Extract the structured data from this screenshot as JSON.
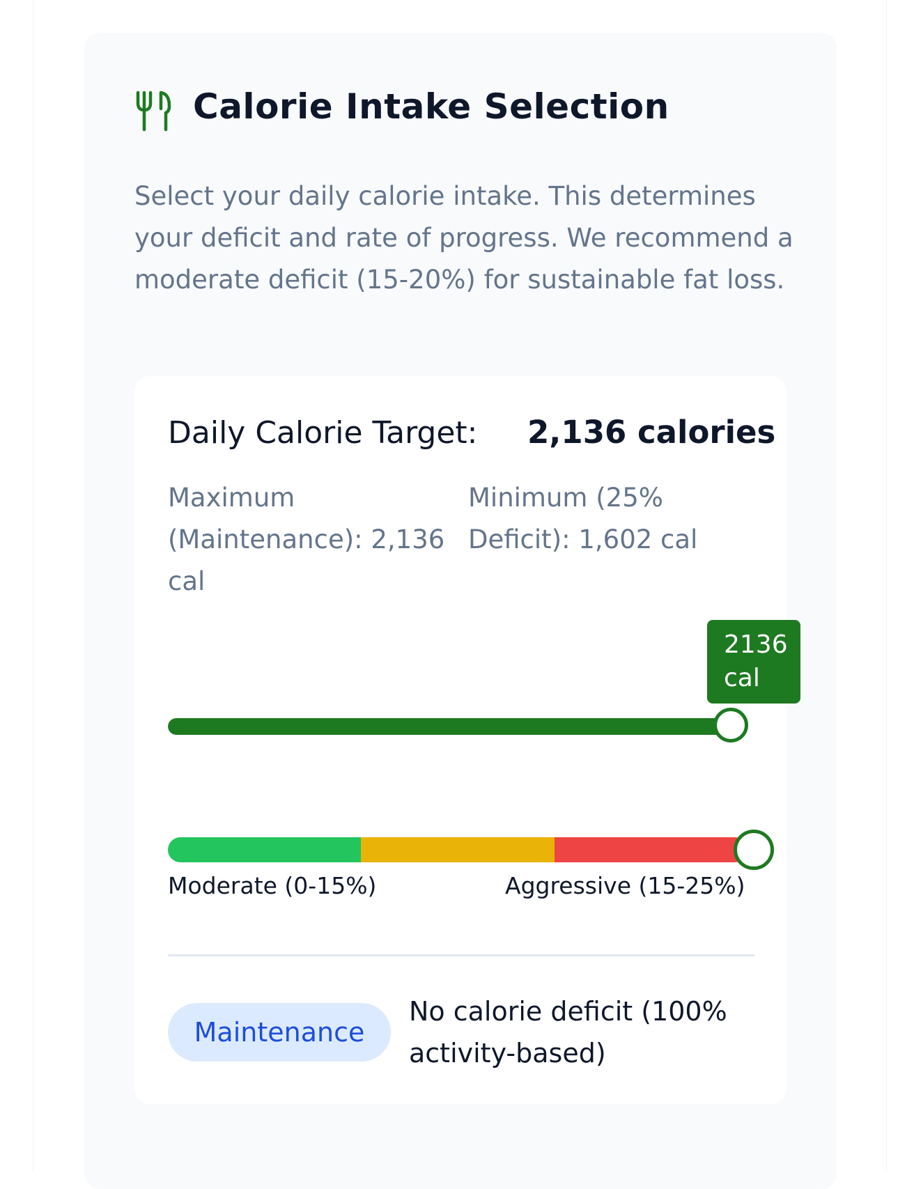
{
  "section": {
    "icon": "utensils-icon",
    "title": "Calorie Intake Selection",
    "description": "Select your daily calorie intake. This determines your deficit and rate of progress. We recommend a moderate deficit (15-20%) for sustainable fat loss."
  },
  "target": {
    "label": "Daily Calorie Target:",
    "value": "2,136 calories",
    "max_text": "Maximum (Maintenance): 2,136 cal",
    "min_text": "Minimum (25% Deficit): 1,602 cal"
  },
  "slider": {
    "min": 1602,
    "max": 2136,
    "value": 2136,
    "tooltip": "2136 cal"
  },
  "deficit_scale": {
    "zones": [
      {
        "name": "green",
        "color": "#22c55e"
      },
      {
        "name": "yellow",
        "color": "#eab308"
      },
      {
        "name": "red",
        "color": "#ef4444"
      }
    ],
    "left_label": "Moderate (0-15%)",
    "right_label": "Aggressive (15-25%)"
  },
  "status": {
    "badge": "Maintenance",
    "description": "No calorie deficit (100% activity-based)"
  },
  "colors": {
    "accent": "#1e7a21",
    "badge_bg": "#dbeafe",
    "badge_text": "#1d4ed8"
  }
}
